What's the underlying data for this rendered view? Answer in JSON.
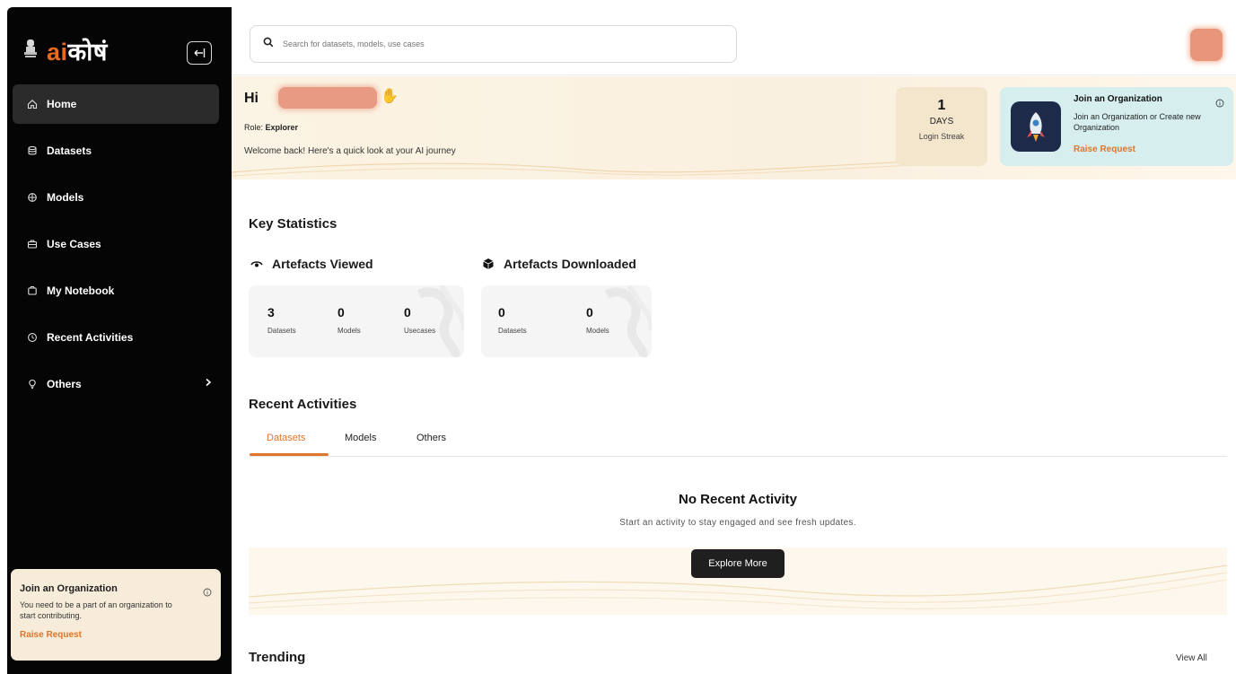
{
  "brand": {
    "prefix": "ai",
    "suffix": "कोषं"
  },
  "sidebar": {
    "items": [
      {
        "label": "Home",
        "icon": "home-icon",
        "active": true
      },
      {
        "label": "Datasets",
        "icon": "database-icon"
      },
      {
        "label": "Models",
        "icon": "model-icon"
      },
      {
        "label": "Use Cases",
        "icon": "briefcase-icon"
      },
      {
        "label": "My Notebook",
        "icon": "notebook-icon"
      },
      {
        "label": "Recent Activities",
        "icon": "clock-icon"
      },
      {
        "label": "Others",
        "icon": "lightbulb-icon",
        "has_submenu": true
      }
    ],
    "org_card": {
      "title": "Join an Organization",
      "description": "You need to be a part of an organization to start contributing.",
      "action": "Raise Request"
    }
  },
  "search": {
    "placeholder": "Search for datasets, models, use cases"
  },
  "hero": {
    "greeting": "Hi",
    "role_label": "Role:",
    "role_value": "Explorer",
    "welcome": "Welcome back! Here's a quick look at your AI journey",
    "streak": {
      "value": "1",
      "unit": "DAYS",
      "label": "Login Streak"
    },
    "join": {
      "title": "Join an Organization",
      "description": "Join an Organization or Create new Organization",
      "action": "Raise Request"
    }
  },
  "key_statistics": {
    "title": "Key Statistics",
    "viewed": {
      "title": "Artefacts Viewed",
      "stats": [
        {
          "value": "3",
          "label": "Datasets"
        },
        {
          "value": "0",
          "label": "Models"
        },
        {
          "value": "0",
          "label": "Usecases"
        }
      ]
    },
    "downloaded": {
      "title": "Artefacts Downloaded",
      "stats": [
        {
          "value": "0",
          "label": "Datasets"
        },
        {
          "value": "0",
          "label": "Models"
        }
      ]
    }
  },
  "recent": {
    "title": "Recent Activities",
    "tabs": [
      "Datasets",
      "Models",
      "Others"
    ],
    "active_tab": "Datasets",
    "empty_title": "No Recent Activity",
    "empty_description": "Start an activity to stay engaged and see fresh updates.",
    "explore_label": "Explore More"
  },
  "trending": {
    "title": "Trending",
    "view_all": "View All"
  },
  "colors": {
    "accent": "#e0752c",
    "sidebar_bg": "#050505",
    "hero_bg": "#fbf3e3",
    "join_bg": "#d6eeee"
  }
}
